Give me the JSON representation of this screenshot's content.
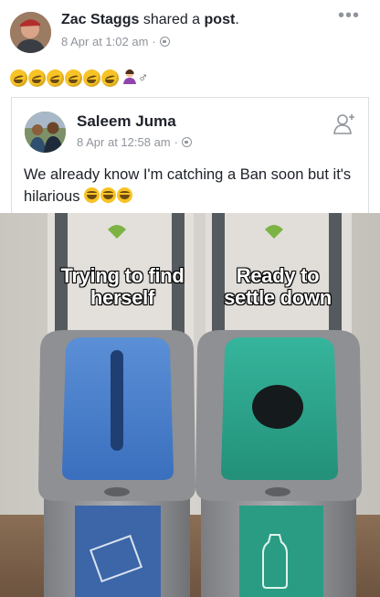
{
  "post": {
    "author": "Zac Staggs",
    "action": "shared a",
    "object": "post",
    "action_end": ".",
    "timestamp": "8 Apr at 1:02 am",
    "more_label": "•••",
    "status_extra": "♂"
  },
  "shared": {
    "author": "Saleem Juma",
    "timestamp": "8 Apr at 12:58 am",
    "text": "We already know I'm catching a Ban soon but it's hilarious"
  },
  "meme": {
    "left_caption": "Trying to find herself",
    "right_caption": "Ready to settle down"
  },
  "colors": {
    "link": "#1d2129",
    "meta": "#90949c",
    "blue_bin": "#3f76c4",
    "green_bin": "#2aa08a"
  }
}
